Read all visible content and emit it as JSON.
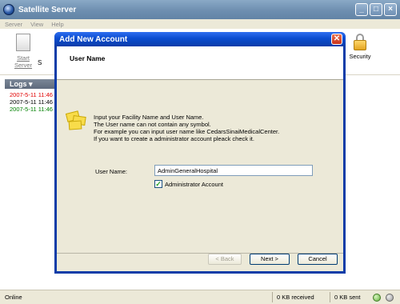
{
  "window": {
    "title": "Satellite Server"
  },
  "menu": [
    "Server",
    "View",
    "Help"
  ],
  "toolbar": {
    "start_server": "Start Server",
    "s_partial": "S",
    "security": "Security"
  },
  "logs": {
    "title": "Logs ▾",
    "lines": [
      {
        "text": "2007-5-11 11:46",
        "color": "#e00000"
      },
      {
        "text": "2007-5-11 11:46",
        "color": "#000000"
      },
      {
        "text": "2007-5-11 11:46",
        "color": "#008000"
      }
    ]
  },
  "dialog": {
    "title": "Add New Account",
    "header": "User Name",
    "intro": [
      "Input your Facility Name and User Name.",
      "The User name can not contain any symbol.",
      "For example you can input user name like  CedarsSinaiMedicalCenter.",
      "If you want to create a administrator account pleack check it."
    ],
    "user_name_label": "User Name:",
    "user_name_value": "AdminGeneralHospital",
    "admin_label": "Administrator Account",
    "admin_checked": true,
    "buttons": {
      "back": "< Back",
      "next": "Next >",
      "cancel": "Cancel"
    }
  },
  "status": {
    "online": "Online",
    "received": "0 KB received",
    "sent": "0 KB sent"
  }
}
